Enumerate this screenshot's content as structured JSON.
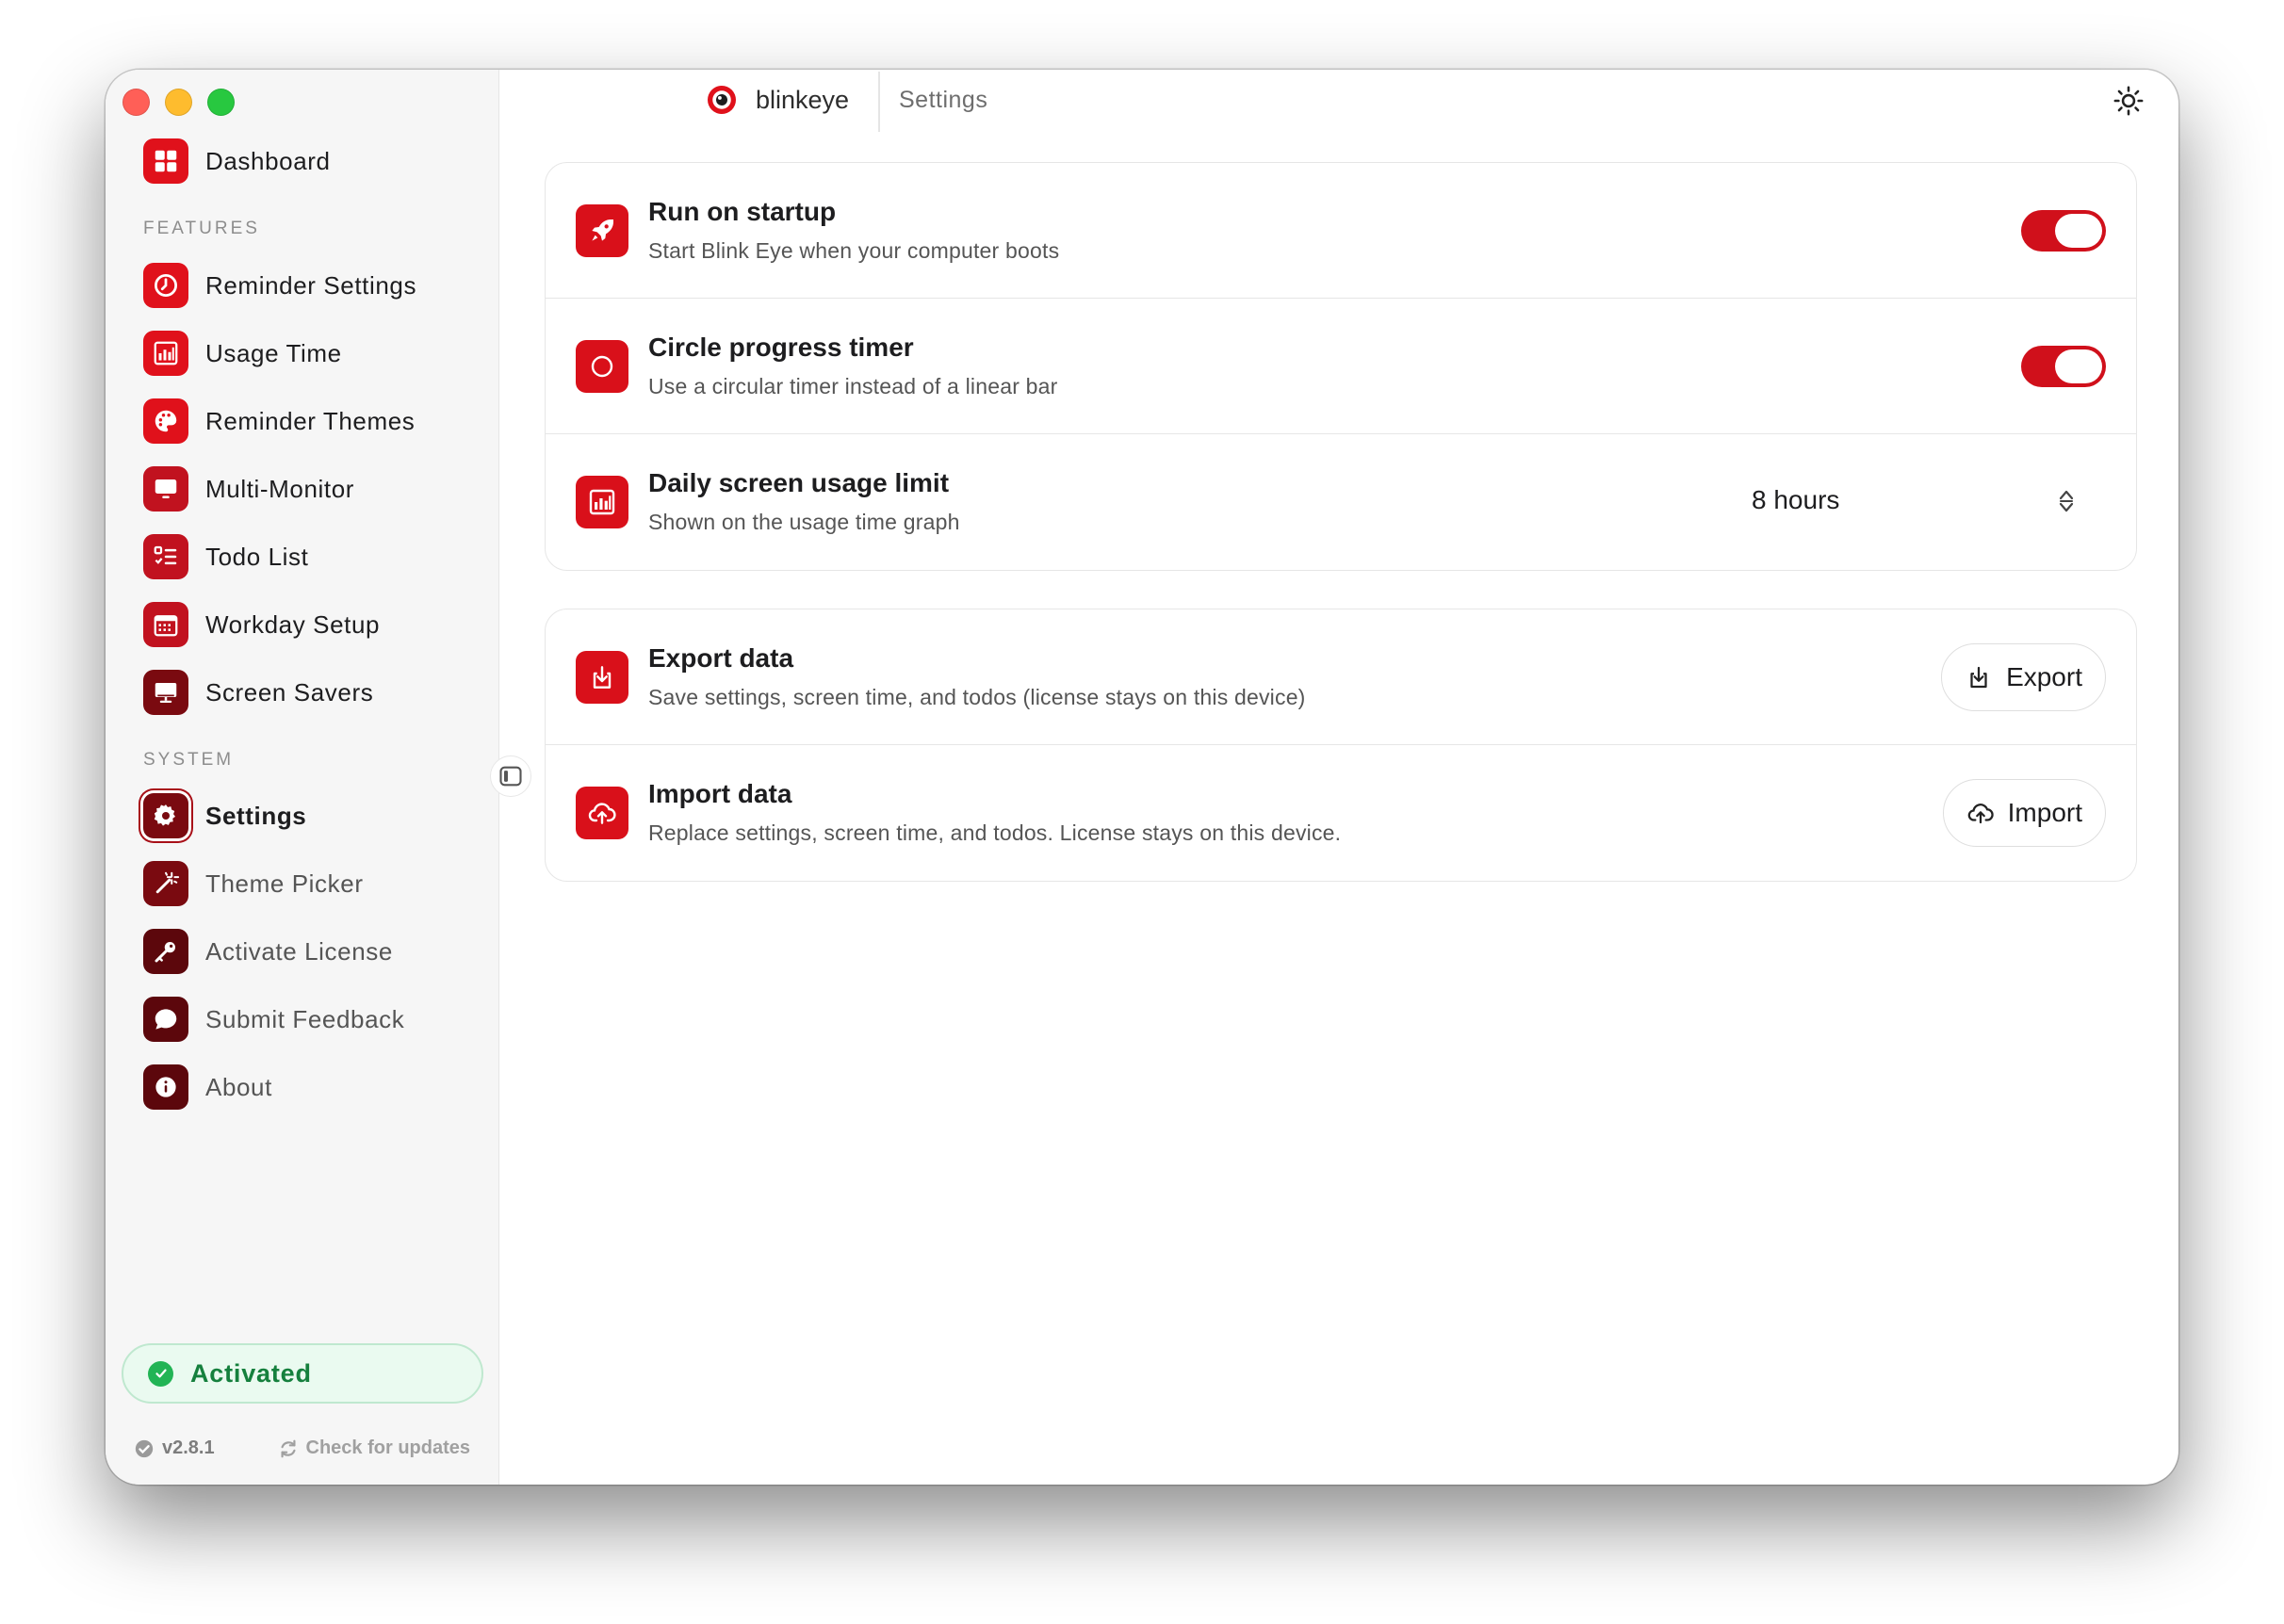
{
  "app": {
    "name": "blinkeye",
    "breadcrumb": "Settings"
  },
  "sidebar": {
    "dashboard": "Dashboard",
    "features_label": "FEATURES",
    "features": [
      {
        "label": "Reminder Settings",
        "icon": "timer-icon"
      },
      {
        "label": "Usage Time",
        "icon": "bar-chart-icon"
      },
      {
        "label": "Reminder Themes",
        "icon": "palette-icon"
      },
      {
        "label": "Multi-Monitor",
        "icon": "monitor-icon"
      },
      {
        "label": "Todo List",
        "icon": "checklist-icon"
      },
      {
        "label": "Workday Setup",
        "icon": "calendar-icon"
      },
      {
        "label": "Screen Savers",
        "icon": "display-icon"
      }
    ],
    "system_label": "SYSTEM",
    "system": [
      {
        "label": "Settings",
        "icon": "gear-icon",
        "active": true
      },
      {
        "label": "Theme Picker",
        "icon": "magic-wand-icon"
      },
      {
        "label": "Activate License",
        "icon": "key-icon"
      },
      {
        "label": "Submit Feedback",
        "icon": "chat-bubble-icon"
      },
      {
        "label": "About",
        "icon": "info-icon"
      }
    ],
    "activated_label": "Activated",
    "version": "v2.8.1",
    "check_updates": "Check for updates"
  },
  "settings": {
    "general": [
      {
        "title": "Run on startup",
        "desc": "Start Blink Eye when your computer boots",
        "enabled": true
      },
      {
        "title": "Circle progress timer",
        "desc": "Use a circular timer instead of a linear bar",
        "enabled": true
      },
      {
        "title": "Daily screen usage limit",
        "desc": "Shown on the usage time graph",
        "value": "8 hours"
      }
    ],
    "data": [
      {
        "title": "Export data",
        "desc": "Save settings, screen time, and todos (license stays on this device)",
        "button": "Export"
      },
      {
        "title": "Import data",
        "desc": "Replace settings, screen time, and todos. License stays on this device.",
        "button": "Import"
      }
    ]
  },
  "colors": {
    "accent": "#d9101a",
    "activated_green": "#15803d"
  }
}
